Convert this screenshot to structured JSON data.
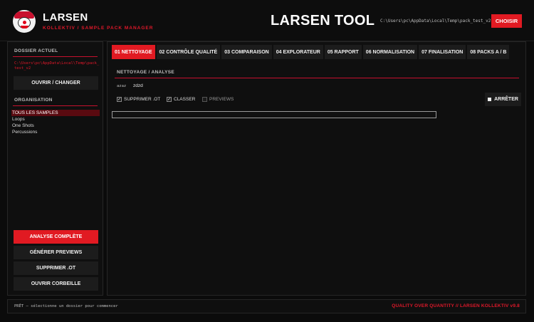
{
  "header": {
    "brand_name": "LARSEN",
    "brand_sub": "KOLLEKTIV  /  SAMPLE PACK MANAGER",
    "app_title": "LARSEN TOOL",
    "path": "C:\\Users\\pc\\AppData\\Local\\Temp\\pack_test_v2",
    "choose_label": "CHOISIR",
    "logo_icon": "clown-logo-icon"
  },
  "sidebar": {
    "current_folder_label": "DOSSIER ACTUEL",
    "current_path": "C:\\Users\\pc\\AppData\\Local\\Temp\\pack_test_v2",
    "open_change_label": "OUVRIR / CHANGER",
    "organisation_label": "ORGANISATION",
    "folders": [
      {
        "label": "TOUS LES SAMPLES",
        "active": true
      },
      {
        "label": "Loops",
        "active": false
      },
      {
        "label": "One Shots",
        "active": false
      },
      {
        "label": "Percussions",
        "active": false
      }
    ],
    "actions": {
      "full_analysis": "ANALYSE COMPLÈTE",
      "generate_previews": "GÉNÉRER PREVIEWS",
      "delete_ot": "SUPPRIMER .OT",
      "open_trash": "OUVRIR CORBEILLE"
    }
  },
  "main": {
    "tabs": [
      {
        "label": "01 NETTOYAGE",
        "active": true
      },
      {
        "label": "02 CONTRÔLE QUALITÉ",
        "active": false
      },
      {
        "label": "03 COMPARAISON",
        "active": false
      },
      {
        "label": "04 EXPLORATEUR",
        "active": false
      },
      {
        "label": "05 RAPPORT",
        "active": false
      },
      {
        "label": "06 NORMALISATION",
        "active": false
      },
      {
        "label": "07 FINALISATION",
        "active": false
      },
      {
        "label": "08 PACKS A / B",
        "active": false
      }
    ],
    "panel_title": "NETTOYAGE / ANALYSE",
    "kv_key": "azaz",
    "kv_value": "zdzd",
    "options": [
      {
        "label": "SUPPRIMER .OT",
        "checked": true
      },
      {
        "label": "CLASSER",
        "checked": true
      },
      {
        "label": "PREVIEWS",
        "checked": false
      }
    ],
    "stop_label": "ARRÊTER",
    "progress": 0
  },
  "footer": {
    "status": "PRÊT — sélectionne un dossier pour commencer",
    "tagline": "QUALITY OVER QUANTITY  //  LARSEN KOLLEKTIV  v9.8"
  },
  "colors": {
    "accent": "#e11a22",
    "background": "#0b0b0b",
    "panel": "#0f0f0f",
    "button": "#1c1c1c"
  }
}
